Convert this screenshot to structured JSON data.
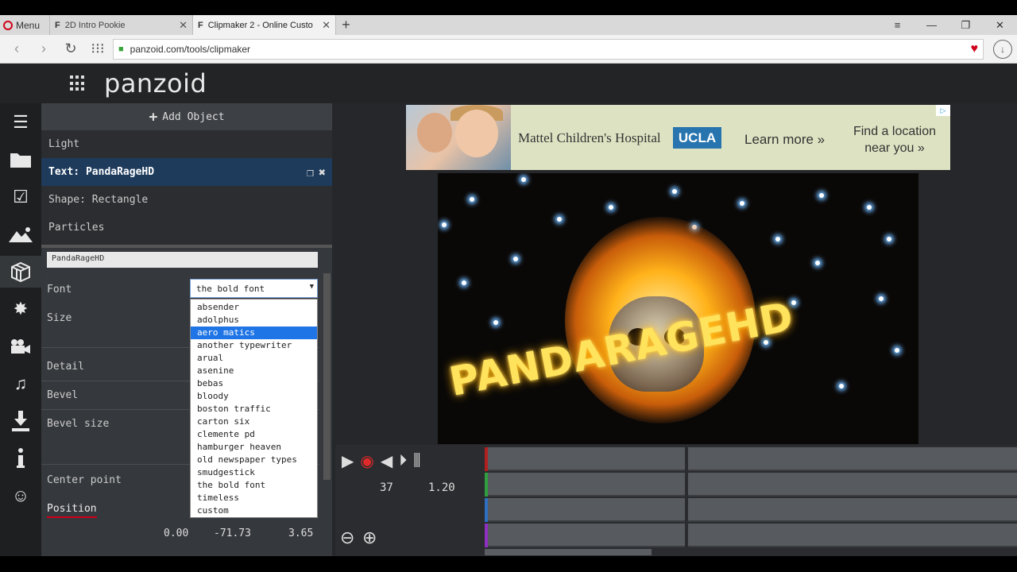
{
  "browser": {
    "menu_label": "Menu",
    "tabs": [
      {
        "title": "2D Intro Pookie",
        "favicon": "F"
      },
      {
        "title": "Clipmaker 2 - Online Custo",
        "favicon": "F"
      }
    ],
    "new_tab": "+",
    "url": "panzoid.com/tools/clipmaker"
  },
  "app": {
    "logo": "panzoid"
  },
  "objects": {
    "add_label": "Add Object",
    "items": [
      {
        "label": "Light"
      },
      {
        "label": "Text: PandaRageHD"
      },
      {
        "label": "Shape: Rectangle"
      },
      {
        "label": "Particles"
      }
    ]
  },
  "properties": {
    "text_value": "PandaRageHD",
    "labels": {
      "font": "Font",
      "size": "Size",
      "detail": "Detail",
      "bevel": "Bevel",
      "bevel_size": "Bevel size",
      "center_point": "Center point",
      "position": "Position"
    },
    "font_selected": "the bold font",
    "font_options": [
      "absender",
      "adolphus",
      "aero matics",
      "another typewriter",
      "arual",
      "asenine",
      "bebas",
      "bloody",
      "boston traffic",
      "carton six",
      "clemente pd",
      "hamburger heaven",
      "old newspaper types",
      "smudgestick",
      "the bold font",
      "timeless",
      "custom"
    ],
    "highlighted_option": "aero matics",
    "position_values": [
      "0.00",
      "-71.73",
      "3.65"
    ]
  },
  "ad": {
    "hospital": "Mattel Children's Hospital",
    "brand": "UCLA",
    "learn_more": "Learn more »",
    "find_location": "Find a location near you »"
  },
  "preview": {
    "title_text": "PANDARAGEHD"
  },
  "timeline": {
    "frame": "37",
    "time": "1.20",
    "track_colors": [
      "#b02020",
      "#2e9e3e",
      "#2f6fbf",
      "#8e2fbf"
    ]
  },
  "colors": {
    "accent": "#1f74e6",
    "selected_row": "#1e3b5c",
    "underline": "#d0021b"
  }
}
